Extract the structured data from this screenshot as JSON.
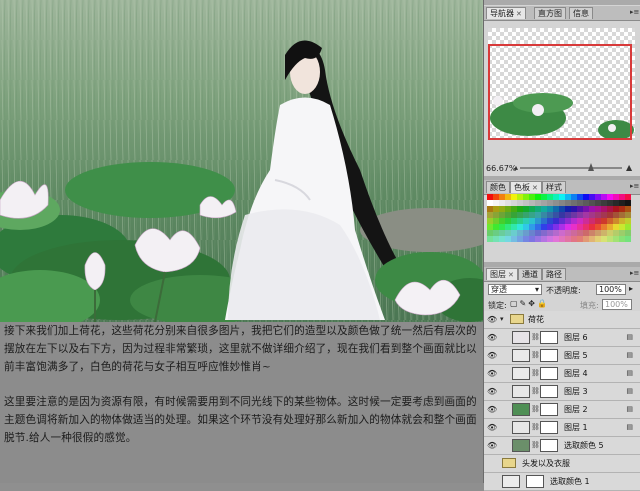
{
  "article": {
    "paragraph1": "接下来我们加上荷花，这些荷花分别来自很多图片，我把它们的造型以及颜色做了统一然后有层次的摆放在左下以及右下方，因为过程非常繁琐，这里就不做详细介绍了，现在我们看到整个画面就比以前丰富饱满多了，白色的荷花与女子相互呼应惟妙惟肖~",
    "paragraph2": "这里要注意的是因为资源有限，有时候需要用到不同光线下的某些物体。这时候一定要考虑到画面的主题色调将新加入的物体做适当的处理。如果这个环节没有处理好那么新加入的物体就会和整个画面脱节.给人一种很假的感觉。"
  },
  "navigator_panel": {
    "tabs": [
      "导航器",
      "直方图",
      "信息"
    ],
    "zoom": "66.67%"
  },
  "color_panel": {
    "tabs": [
      "颜色",
      "色板",
      "样式"
    ]
  },
  "layers_panel": {
    "tabs": [
      "图层",
      "通道",
      "路径"
    ],
    "blend_mode": "穿透",
    "opacity_label": "不透明度:",
    "opacity_value": "100%",
    "lock_label": "锁定:",
    "fill_label": "填充:",
    "fill_value": "100%",
    "group_name": "荷花",
    "layers": [
      {
        "name": "图层 6",
        "visible": true
      },
      {
        "name": "图层 5",
        "visible": true
      },
      {
        "name": "图层 4",
        "visible": true
      },
      {
        "name": "图层 3",
        "visible": true
      },
      {
        "name": "图层 2",
        "visible": true
      },
      {
        "name": "图层 1",
        "visible": true
      },
      {
        "name": "选取颜色 5",
        "visible": true
      },
      {
        "name": "头发以及衣服",
        "visible": false
      },
      {
        "name": "选取颜色 1",
        "visible": false
      }
    ]
  },
  "colors": {
    "navigator_frame": "#d83a3a",
    "panel_bg": "#d4d4d4",
    "text_area_bg": "#8c8c8c"
  }
}
